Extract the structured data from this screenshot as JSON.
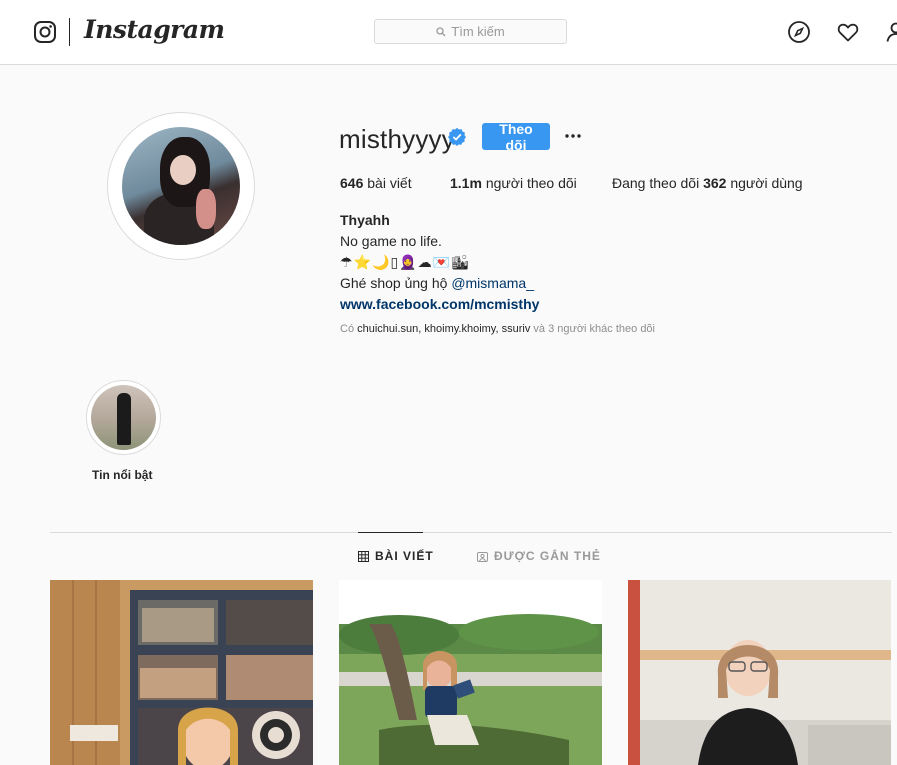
{
  "nav": {
    "brand": "Instagram",
    "search_placeholder": "Tìm kiếm"
  },
  "profile": {
    "username": "misthyyyy",
    "verified": true,
    "follow_label": "Theo dõi",
    "stats": {
      "posts_count": "646",
      "posts_label": "bài viết",
      "followers_count": "1.1m",
      "followers_label": "người theo dõi",
      "following_prefix": "Đang theo dõi",
      "following_count": "362",
      "following_suffix": "người dùng"
    },
    "bio": {
      "full_name": "Thyahh",
      "line1": "No game no life.",
      "emojis": [
        "☂",
        "⭐",
        "🌙",
        "▯",
        "🧕",
        "☁",
        "💌",
        "🏙"
      ],
      "shop_text": "Ghé shop ủng hộ ",
      "shop_mention": "@mismama_",
      "link": "www.facebook.com/mcmisthy"
    },
    "followed_by": {
      "prefix": "Có ",
      "names": "chuichui.sun, khoimy.khoimy, ssuriv",
      "suffix": " và 3 người khác theo dõi"
    }
  },
  "highlights": [
    {
      "label": "Tin nổi bật"
    }
  ],
  "tabs": [
    {
      "label": "BÀI VIẾT",
      "icon": "grid-icon",
      "active": true
    },
    {
      "label": "ĐƯỢC GẮN THẺ",
      "icon": "tag-icon",
      "active": false
    }
  ],
  "colors": {
    "accent": "#3897f0",
    "link": "#003569",
    "muted": "#8e8e8e",
    "border": "#dbdbdb"
  }
}
